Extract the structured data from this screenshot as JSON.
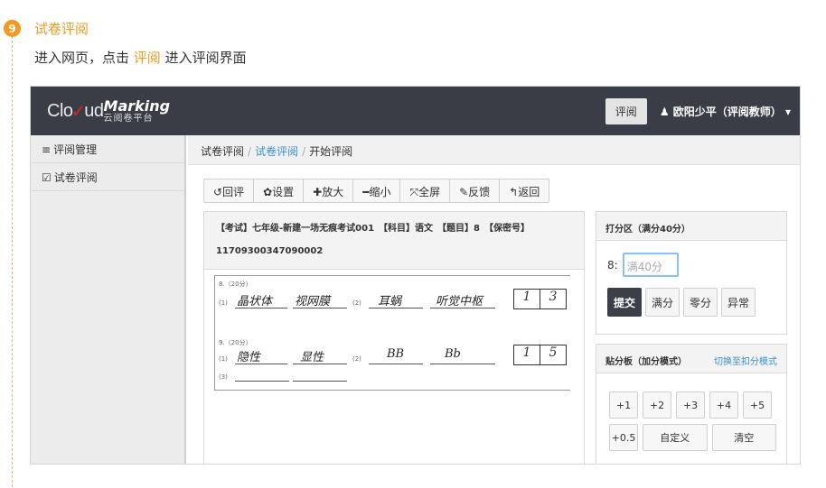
{
  "step": {
    "number": "9",
    "title": "试卷评阅",
    "desc_pre": "进入网页，点击 ",
    "desc_hl": "评阅",
    "desc_post": " 进入评阅界面"
  },
  "app": {
    "logo": {
      "cloud": "Cl",
      "o": "o",
      "ud": "ud",
      "marking": "Marking",
      "sub": "云阅卷平台"
    },
    "header": {
      "review_button": "评阅",
      "user_icon": "user-icon",
      "user": "欧阳少平（评阅教师）",
      "caret": "▾"
    },
    "sidebar": {
      "items": [
        {
          "icon": "≡",
          "label": "评阅管理"
        },
        {
          "icon": "☑",
          "label": "试卷评阅"
        }
      ]
    },
    "breadcrumb": {
      "a": "试卷评阅",
      "b": "试卷评阅",
      "c": "开始评阅",
      "sep": "/"
    },
    "toolbar": [
      {
        "icon": "↺",
        "label": "回评"
      },
      {
        "icon": "✿",
        "label": "设置"
      },
      {
        "icon": "✚",
        "label": "放大"
      },
      {
        "icon": "━",
        "label": "缩小"
      },
      {
        "icon": "⤧",
        "label": "全屏"
      },
      {
        "icon": "✎",
        "label": "反馈"
      },
      {
        "icon": "↰",
        "label": "返回"
      }
    ],
    "paper": {
      "info": "【考试】七年级-新建一场无痕考试001　【科目】语文　【题目】8　【保密号】",
      "id": "11709300347090002",
      "q8": {
        "head": "8.（20分）",
        "n1": "(1)",
        "n2": "(2)",
        "a1": "晶状体",
        "a2": "视网膜",
        "a3": "耳蜗",
        "a4": "听觉中枢",
        "s1": "1",
        "s2": "3"
      },
      "q9": {
        "head": "9.（20分）",
        "n1": "(1)",
        "n2": "(2)",
        "n3": "(3)",
        "a1": "隐性",
        "a2": "显性",
        "a3": "BB",
        "a4": "Bb",
        "s1": "1",
        "s2": "5"
      }
    },
    "score": {
      "title": "打分区（满分40分）",
      "label": "8:",
      "placeholder": "满40分",
      "buttons": [
        "提交",
        "满分",
        "零分",
        "异常"
      ]
    },
    "paste": {
      "title": "贴分板（加分模式）",
      "switch": "切换至扣分模式",
      "row1": [
        "+1",
        "+2",
        "+3",
        "+4",
        "+5"
      ],
      "row2": [
        "+0.5",
        "自定义",
        "清空"
      ]
    }
  }
}
